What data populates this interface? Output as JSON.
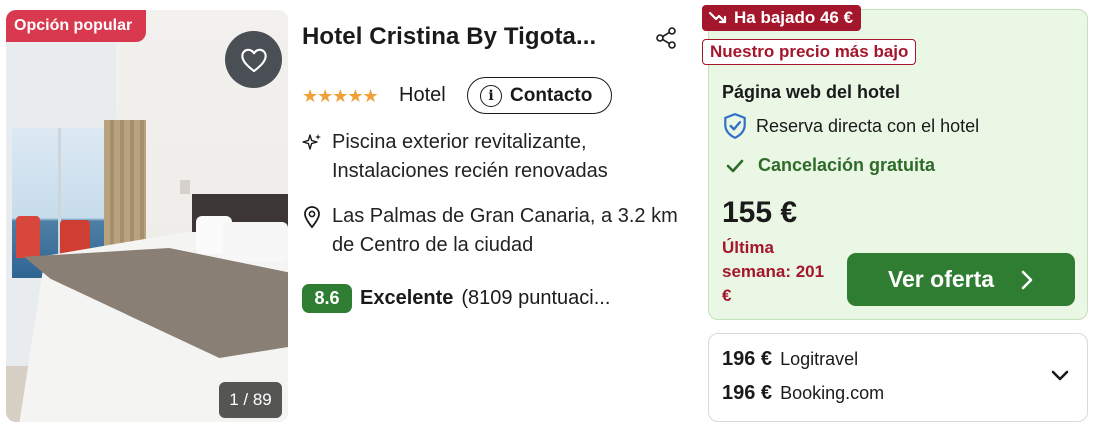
{
  "photo": {
    "badge": "Opción popular",
    "counter": "1 / 89"
  },
  "hotel": {
    "name": "Hotel Cristina By Tigota...",
    "stars": "★★★★★",
    "type": "Hotel",
    "contact_label": "Contacto",
    "features": "Piscina exterior revitalizante, Instalaciones recién renovadas",
    "location": "Las Palmas de Gran Canaria, a 3.2 km de Centro de la ciudad",
    "rating": {
      "score": "8.6",
      "label": "Excelente",
      "count": "(8109 puntuaci..."
    }
  },
  "deal": {
    "drop_badge": "Ha bajado 46 €",
    "lowest_badge": "Nuestro precio más bajo",
    "provider": "Página web del hotel",
    "direct_booking": "Reserva directa con el hotel",
    "cancellation": "Cancelación gratuita",
    "price": "155 €",
    "last_week": "Última semana: 201 €",
    "cta": "Ver oferta",
    "colors": {
      "green": "#2f7d32",
      "red": "#a4162b",
      "panel": "#eaf7e5"
    }
  },
  "other_offers": [
    {
      "price": "196 €",
      "provider": "Logitravel"
    },
    {
      "price": "196 €",
      "provider": "Booking.com"
    }
  ],
  "icons": [
    "heart-icon",
    "share-icon",
    "info-icon",
    "sparkle-icon",
    "location-pin-icon",
    "trend-down-icon",
    "shield-check-icon",
    "checkmark-icon",
    "chevron-right-icon",
    "chevron-down-icon"
  ]
}
